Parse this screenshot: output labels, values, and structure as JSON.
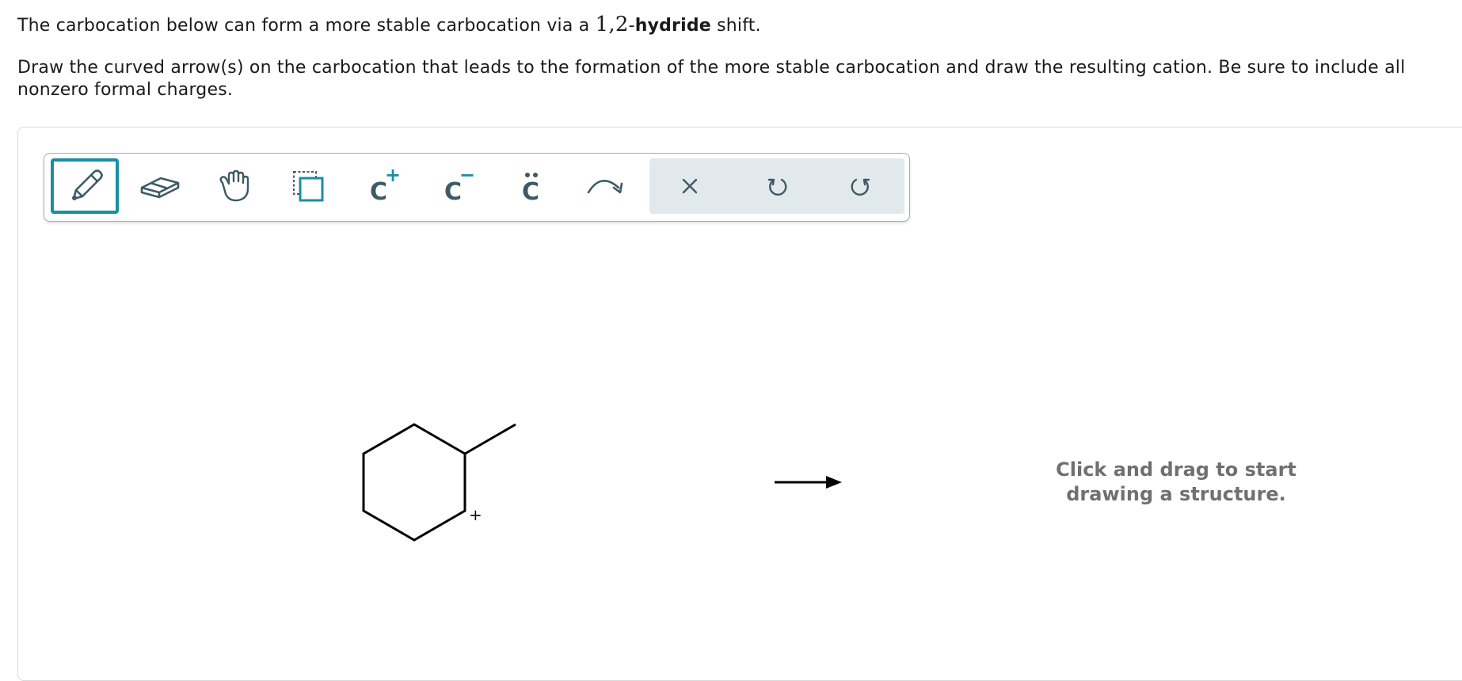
{
  "question": {
    "line1_before": "The carbocation below can form a more stable carbocation via a ",
    "line1_number": "1,2",
    "line1_dash": "-",
    "line1_bold": "hydride",
    "line1_after": " shift.",
    "instructions": "Draw the curved arrow(s) on the carbocation that leads to the formation of the more stable carbocation and draw the resulting cation. Be sure to include all nonzero formal charges."
  },
  "toolbar": {
    "tools": [
      {
        "name": "pencil-tool",
        "icon": "pencil-icon",
        "selected": true
      },
      {
        "name": "eraser-tool",
        "icon": "eraser-icon",
        "selected": false
      },
      {
        "name": "hand-tool",
        "icon": "hand-icon",
        "selected": false
      },
      {
        "name": "select-tool",
        "icon": "select-box-icon",
        "selected": false
      },
      {
        "name": "positive-charge-tool",
        "icon": "carbocation-icon",
        "label": "C",
        "sup": "+",
        "selected": false
      },
      {
        "name": "negative-charge-tool",
        "icon": "carbanion-icon",
        "label": "C",
        "sup": "−",
        "selected": false
      },
      {
        "name": "lone-pair-tool",
        "icon": "lone-pair-icon",
        "label": "C",
        "selected": false
      },
      {
        "name": "curved-arrow-tool",
        "icon": "curved-arrow-icon",
        "selected": false
      }
    ],
    "actions": [
      {
        "name": "clear-button",
        "icon": "close-icon"
      },
      {
        "name": "undo-button",
        "icon": "undo-icon"
      },
      {
        "name": "redo-button",
        "icon": "redo-icon"
      }
    ]
  },
  "molecule": {
    "charge_label": "+"
  },
  "drawing_area": {
    "hint": "Click and drag to start\ndrawing a structure."
  },
  "colors": {
    "accent": "#1a8ea5",
    "icon": "#3d5a66",
    "action_bg": "#e2e9ec",
    "hint_text": "#707070"
  }
}
